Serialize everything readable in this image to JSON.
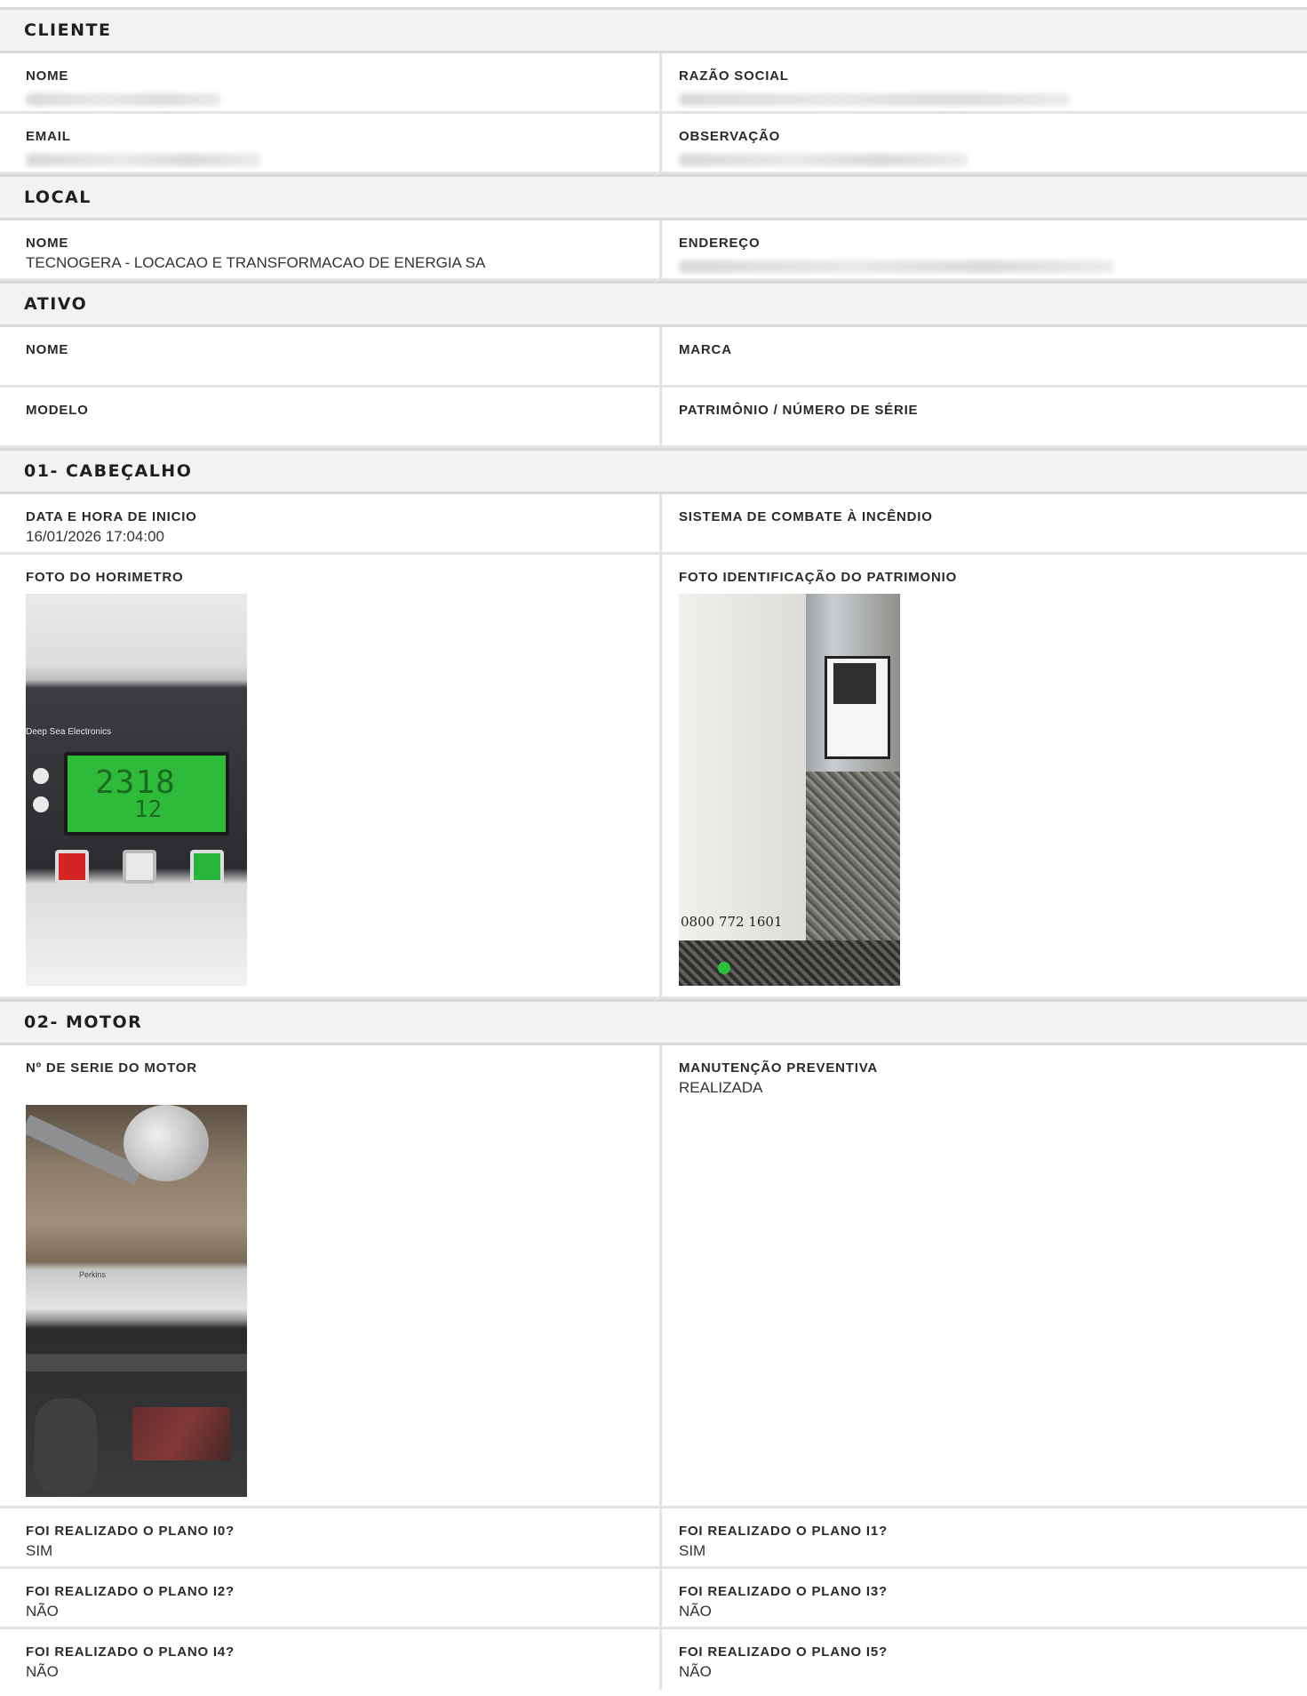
{
  "cliente": {
    "title": "CLIENTE",
    "nome_label": "NOME",
    "razao_label": "RAZÃO SOCIAL",
    "email_label": "EMAIL",
    "observacao_label": "OBSERVAÇÃO"
  },
  "local": {
    "title": "LOCAL",
    "nome_label": "NOME",
    "nome_value": "TECNOGERA - LOCACAO E TRANSFORMACAO DE ENERGIA SA",
    "endereco_label": "ENDEREÇO"
  },
  "ativo": {
    "title": "ATIVO",
    "nome_label": "NOME",
    "marca_label": "MARCA",
    "modelo_label": "MODELO",
    "patrimonio_label": "PATRIMÔNIO / NÚMERO DE SÉRIE"
  },
  "cabecalho": {
    "title": "01- CABEÇALHO",
    "data_label": "DATA E HORA DE INICIO",
    "data_value": "16/01/2026 17:04:00",
    "sistema_label": "SISTEMA DE COMBATE À INCÊNDIO",
    "foto_horimetro_label": "FOTO DO HORIMETRO",
    "foto_patrimonio_label": "FOTO IDENTIFICAÇÃO DO PATRIMONIO",
    "photo1_brand": "Deep Sea Electronics",
    "photo1_hours": "2318",
    "photo1_small": "12",
    "photo2_phone": "0800 772 1601"
  },
  "motor": {
    "title": "02- MOTOR",
    "serie_label": "Nº DE SERIE DO MOTOR",
    "manutencao_label": "MANUTENÇÃO PREVENTIVA",
    "manutencao_value": "REALIZADA",
    "photo3_brand": "Perkins",
    "planos": [
      {
        "label": "FOI REALIZADO O PLANO I0?",
        "value": "SIM"
      },
      {
        "label": "FOI REALIZADO O PLANO I1?",
        "value": "SIM"
      },
      {
        "label": "FOI REALIZADO O PLANO I2?",
        "value": "NÃO"
      },
      {
        "label": "FOI REALIZADO O PLANO I3?",
        "value": "NÃO"
      },
      {
        "label": "FOI REALIZADO O PLANO I4?",
        "value": "NÃO"
      },
      {
        "label": "FOI REALIZADO O PLANO I5?",
        "value": "NÃO"
      }
    ]
  }
}
